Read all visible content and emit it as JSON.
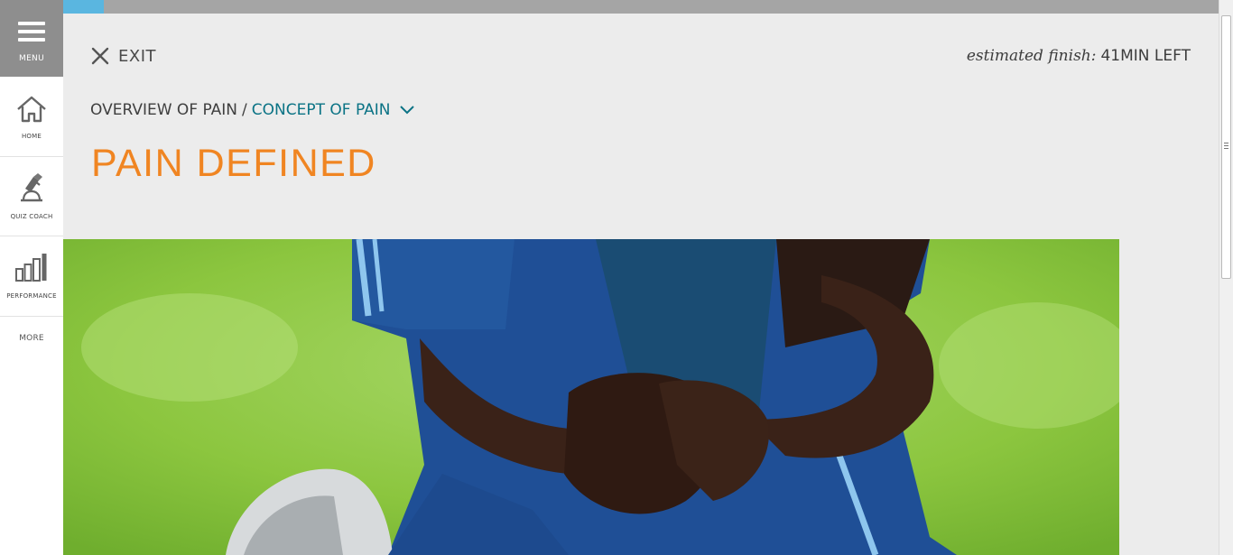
{
  "sidebar": {
    "menu_label": "MENU",
    "items": [
      {
        "label": "HOME",
        "icon": "home-icon"
      },
      {
        "label": "QUIZ COACH",
        "icon": "quiz-coach-icon"
      },
      {
        "label": "PERFORMANCE",
        "icon": "performance-chart-icon"
      }
    ],
    "more_label": "MORE"
  },
  "progress": {
    "fraction": 0.035
  },
  "header": {
    "exit_label": "EXIT",
    "estimated_finish_prefix": "estimated finish:",
    "estimated_finish_value": "41MIN LEFT"
  },
  "breadcrumb": {
    "parent": "OVERVIEW OF PAIN",
    "separator": "/",
    "current": "CONCEPT OF PAIN"
  },
  "page": {
    "title": "PAIN DEFINED"
  },
  "colors": {
    "accent_orange": "#f08522",
    "link_teal": "#0b7385",
    "progress_blue": "#5ab6e0",
    "menu_gray": "#8e8e8e",
    "background": "#ececec"
  }
}
